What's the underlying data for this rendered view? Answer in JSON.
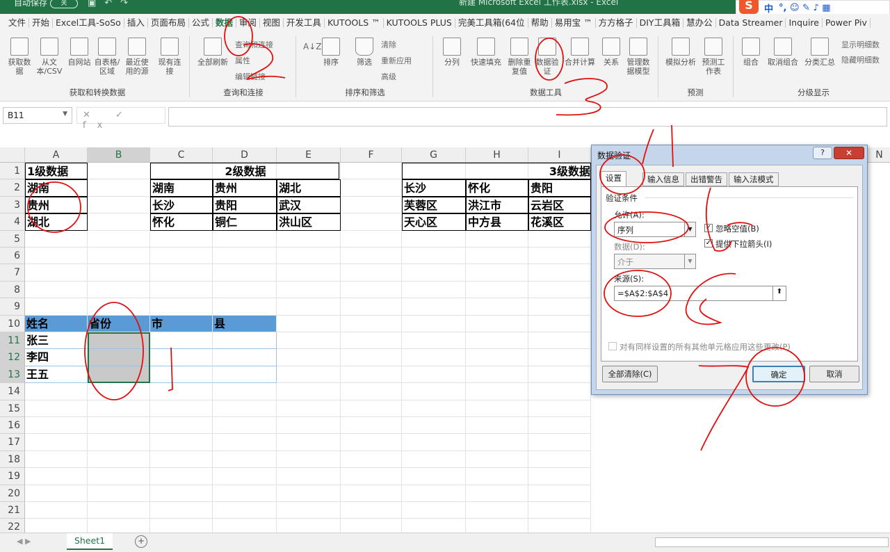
{
  "titlebar": {
    "autosave": "自动保存",
    "toggle": "关",
    "title": "新建 Microsoft Excel 工作表.xlsx - Excel"
  },
  "ime": {
    "logo": "S",
    "lang": "中",
    "icons": "°, ☺ ✎ ♪ ▦"
  },
  "menu": [
    "文件",
    "开始",
    "Excel工具-SoSo",
    "插入",
    "页面布局",
    "公式",
    "数据",
    "审阅",
    "视图",
    "开发工具",
    "KUTOOLS ™",
    "KUTOOLS PLUS",
    "完美工具箱(64位",
    "帮助",
    "易用宝 ™",
    "方方格子",
    "DIY工具箱",
    "慧办公",
    "Data Streamer",
    "Inquire",
    "Power Piv"
  ],
  "ribbon": {
    "get": {
      "b1": "获取数据",
      "b2": "从文本/CSV",
      "b3": "自网站",
      "b4": "自表格/区域",
      "b5": "最近使用的源",
      "b6": "现有连接",
      "label": "获取和转换数据"
    },
    "query": {
      "refresh": "全部刷新",
      "s1": "查询和连接",
      "s2": "属性",
      "s3": "编辑链接",
      "label": "查询和连接"
    },
    "sort": {
      "az": "A↓Z",
      "sort": "排序",
      "filter": "筛选",
      "clear": "清除",
      "reapply": "重新应用",
      "advanced": "高级",
      "label": "排序和筛选"
    },
    "tools": {
      "split": "分列",
      "flash": "快速填充",
      "dup": "删除重复值",
      "valid": "数据验证",
      "merge": "合并计算",
      "rel": "关系",
      "model": "管理数据模型",
      "label": "数据工具"
    },
    "forecast": {
      "whatif": "模拟分析",
      "sheet": "预测工作表",
      "label": "预测"
    },
    "outline": {
      "group": "组合",
      "ungroup": "取消组合",
      "subtotal": "分类汇总",
      "show": "显示明细数",
      "hide": "隐藏明细数",
      "label": "分级显示"
    }
  },
  "formula": {
    "namebox": "B11",
    "icons": "✕ ✓ fx",
    "value": ""
  },
  "columns": [
    "A",
    "B",
    "C",
    "D",
    "E",
    "F",
    "G",
    "H",
    "I",
    "N"
  ],
  "rows": [
    "1",
    "2",
    "3",
    "4",
    "5",
    "6",
    "7",
    "8",
    "9",
    "10",
    "11",
    "12",
    "13",
    "14",
    "15",
    "16",
    "17",
    "18",
    "19",
    "20",
    "21",
    "22"
  ],
  "cells": {
    "a1": "1级数据",
    "c1": "2级数据",
    "i1": "3级数据",
    "a2": "湖南",
    "a3": "贵州",
    "a4": "湖北",
    "c2": "湖南",
    "d2": "贵州",
    "e2": "湖北",
    "c3": "长沙",
    "d3": "贵阳",
    "e3": "武汉",
    "c4": "怀化",
    "d4": "铜仁",
    "e4": "洪山区",
    "g2": "长沙",
    "h2": "怀化",
    "i2": "贵阳",
    "g3": "芙蓉区",
    "h3": "洪江市",
    "i3": "云岩区",
    "g4": "天心区",
    "h4": "中方县",
    "i4": "花溪区",
    "a10": "姓名",
    "b10": "省份",
    "c10": "市",
    "d10": "县",
    "a11": "张三",
    "a12": "李四",
    "a13": "王五"
  },
  "sheet": {
    "tab": "Sheet1",
    "add": "+"
  },
  "dialog": {
    "title": "数据验证",
    "help": "?",
    "close": "✕",
    "tabs": [
      "设置",
      "输入信息",
      "出错警告",
      "输入法模式"
    ],
    "criteria": "验证条件",
    "allow_label": "允许(A):",
    "allow_value": "序列",
    "ignore_blank": "忽略空值(B)",
    "dropdown": "提供下拉箭头(I)",
    "data_label": "数据(D):",
    "data_value": "介于",
    "source_label": "来源(S):",
    "source_value": "=$A$2:$A$4",
    "apply_all": "对有同样设置的所有其他单元格应用这些更改(P)",
    "clear_all": "全部清除(C)",
    "ok": "确定",
    "cancel": "取消"
  }
}
